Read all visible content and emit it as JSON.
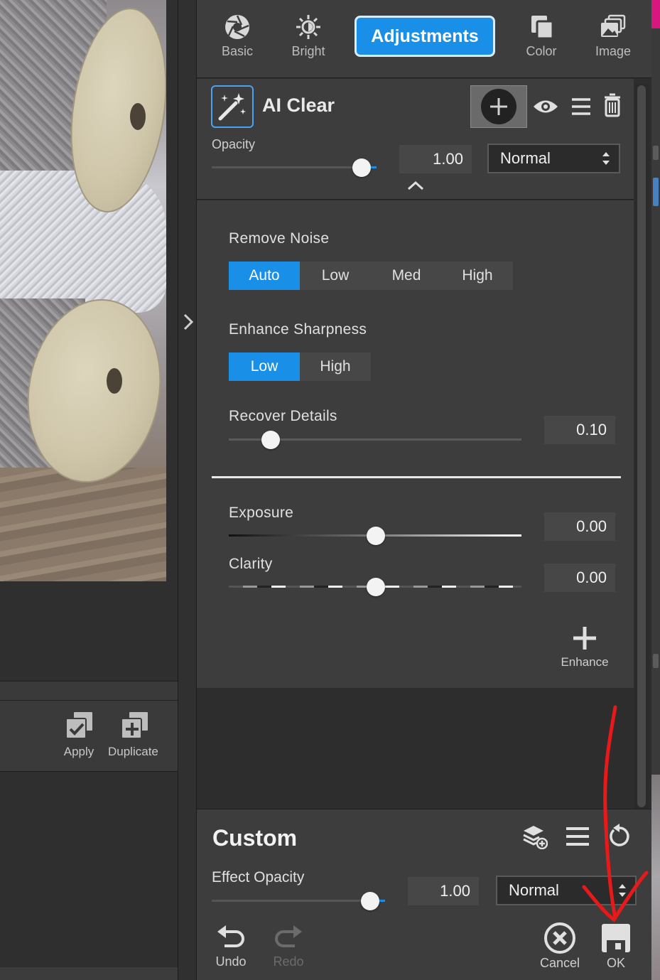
{
  "tabs": [
    {
      "label": "Basic",
      "icon": "aperture-icon"
    },
    {
      "label": "Bright",
      "icon": "sun-icon"
    },
    {
      "label": "Adjustments",
      "icon": ""
    },
    {
      "label": "Color",
      "icon": "color-layers-icon"
    },
    {
      "label": "Image",
      "icon": "image-stack-icon"
    }
  ],
  "active_tab": "Adjustments",
  "layer": {
    "title": "AI Clear",
    "opacity_label": "Opacity",
    "opacity_value": "1.00",
    "opacity_fraction": 1.0,
    "blend_mode": "Normal"
  },
  "effect": {
    "remove_noise": {
      "label": "Remove Noise",
      "options": [
        "Auto",
        "Low",
        "Med",
        "High"
      ],
      "selected": "Auto"
    },
    "enhance_sharpness": {
      "label": "Enhance Sharpness",
      "options": [
        "Low",
        "High"
      ],
      "selected": "Low"
    },
    "recover_details": {
      "label": "Recover Details",
      "value": "0.10",
      "fraction": 0.1
    },
    "exposure": {
      "label": "Exposure",
      "value": "0.00",
      "fraction": 0.5
    },
    "clarity": {
      "label": "Clarity",
      "value": "0.00",
      "fraction": 0.5
    },
    "enhance_label": "Enhance"
  },
  "left_actions": {
    "apply_label": "Apply",
    "duplicate_label": "Duplicate"
  },
  "preset": {
    "title": "Custom",
    "effect_opacity_label": "Effect Opacity",
    "effect_opacity_value": "1.00",
    "effect_opacity_fraction": 1.0,
    "blend_mode": "Normal"
  },
  "bottom_buttons": {
    "undo": "Undo",
    "redo": "Redo",
    "cancel": "Cancel",
    "ok": "OK"
  },
  "colors": {
    "accent": "#1a8fe8",
    "panel": "#3d3d3d",
    "annotation": "#e8191a"
  }
}
